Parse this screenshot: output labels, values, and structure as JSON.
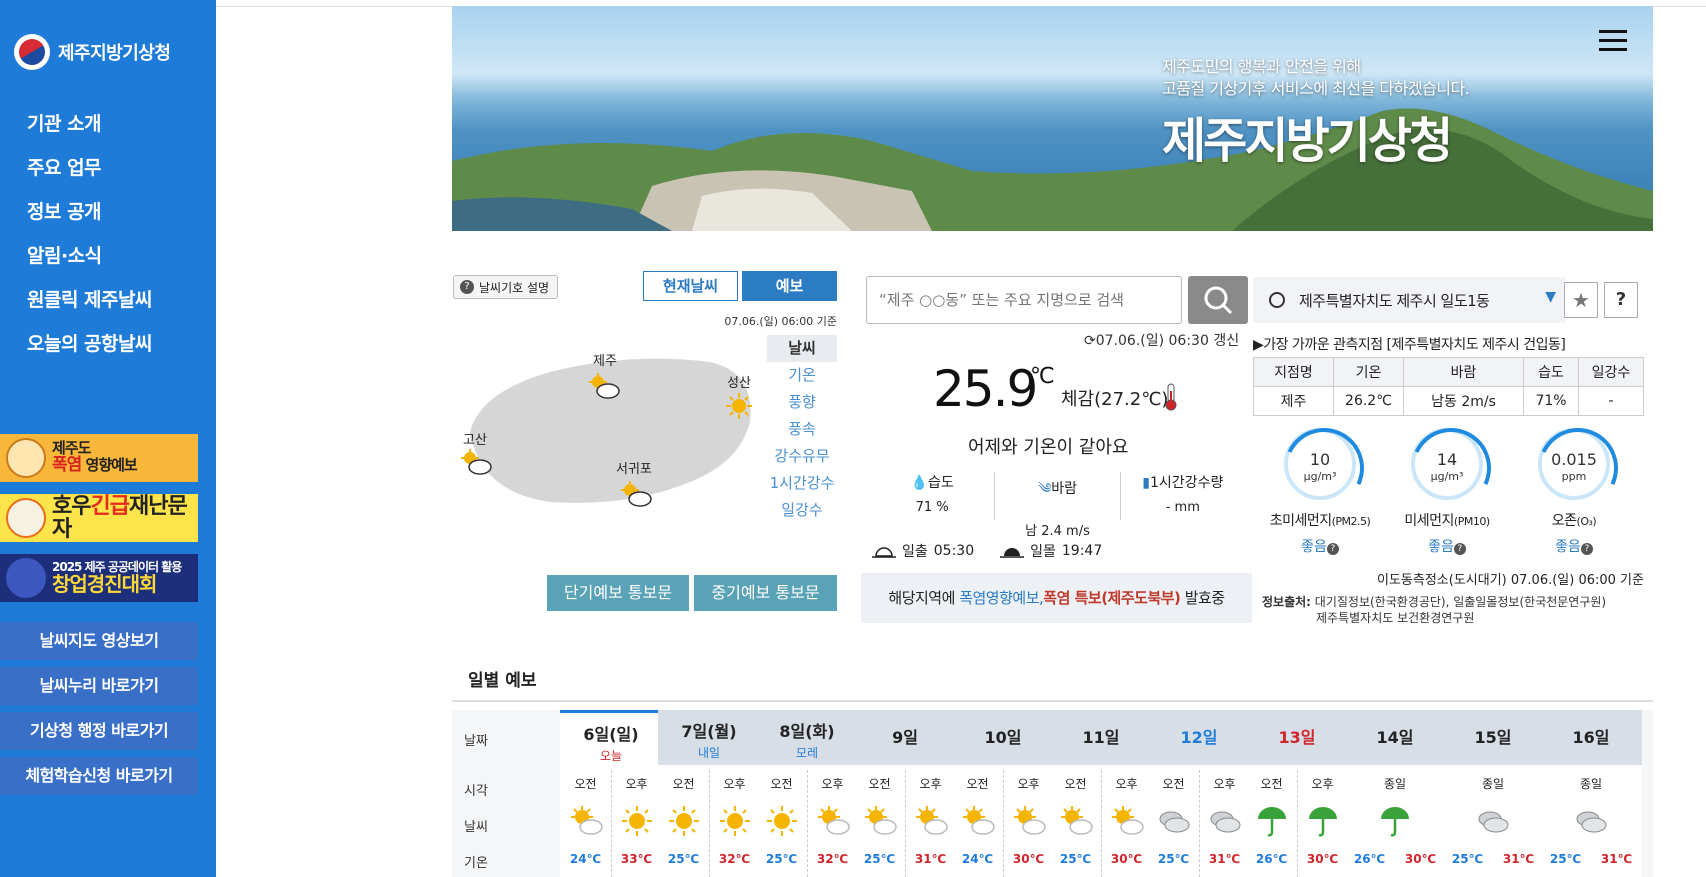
{
  "sidebar": {
    "logo_text": "제주지방기상청",
    "nav": [
      "기관 소개",
      "주요 업무",
      "정보 공개",
      "알림·소식",
      "원클릭 제주날씨",
      "오늘의 공항날씨"
    ],
    "banners": {
      "b1_top": "제주도",
      "b1_hl": "폭염",
      "b1_rest": "영향예보",
      "b2_pre": "호우",
      "b2_hl": "긴급",
      "b2_post": "재난문자",
      "b3_top": "2025 제주 공공데이터 활용",
      "b3_big": "창업경진대회"
    },
    "quick": [
      "날씨지도 영상보기",
      "날씨누리 바로가기",
      "기상청 행정 바로가기",
      "체험학습신청 바로가기"
    ]
  },
  "hero": {
    "line1": "제주도민의 행복과 안전을 위해",
    "line2": "고품질 기상기후 서비스에 최선을 다하겠습니다.",
    "title": "제주지방기상청"
  },
  "map": {
    "symbol_btn": "날씨기호 설명",
    "tab_current": "현재날씨",
    "tab_forecast": "예보",
    "time": "07.06.(일) 06:00 기준",
    "cities": [
      "제주",
      "성산",
      "고산",
      "서귀포"
    ],
    "layers": [
      "날씨",
      "기온",
      "풍향",
      "풍속",
      "강수유무",
      "1시간강수",
      "일강수"
    ],
    "bulletin_short": "단기예보 통보문",
    "bulletin_mid": "중기예보 통보문"
  },
  "current": {
    "search_placeholder": "“제주 ○○동” 또는 주요 지명으로 검색",
    "updated": "07.06.(일) 06:30 갱신",
    "temp": "25.9",
    "temp_unit": "℃",
    "feels": "체감(27.2℃)",
    "same_as": "어제와 기온이 같아요",
    "humidity_label": "습도",
    "humidity": "71 %",
    "wind_label": "바람",
    "wind": "남 2.4 m/s",
    "rain_label": "1시간강수량",
    "rain": "- mm",
    "sunrise_label": "일출",
    "sunrise": "05:30",
    "sunset_label": "일몰",
    "sunset": "19:47",
    "alert_pre": "해당지역에",
    "alert_a1": "폭염영향예보,",
    "alert_a2": "폭염 특보(제주도북부)",
    "alert_post": "발효중"
  },
  "location": {
    "name": "제주특별자치도 제주시 일도1동",
    "near": "▶가장 가까운 관측지점 [제주특별자치도 제주시 건입동]",
    "table_head": [
      "지점명",
      "기온",
      "바람",
      "습도",
      "일강수"
    ],
    "table_row": [
      "제주",
      "26.2℃",
      "남동 2m/s",
      "71%",
      "-"
    ],
    "dust": [
      {
        "num": "10",
        "unit": "μg/m³",
        "name": "초미세먼지",
        "sub": "(PM2.5)",
        "grade": "좋음"
      },
      {
        "num": "14",
        "unit": "μg/m³",
        "name": "미세먼지",
        "sub": "(PM10)",
        "grade": "좋음"
      },
      {
        "num": "0.015",
        "unit": "ppm",
        "name": "오존",
        "sub": "(O₃)",
        "grade": "좋음"
      }
    ],
    "measure": "이도동측정소(도시대기) 07.06.(일) 06:00 기준",
    "source_label": "정보출처:",
    "source_1": "대기질정보(한국환경공단), 일출일몰정보(한국천문연구원)",
    "source_2": "제주특별자치도 보건환경연구원"
  },
  "daily": {
    "title": "일별 예보",
    "labels": [
      "날짜",
      "시각",
      "날씨",
      "기온"
    ],
    "days": [
      {
        "d": "6일(일)",
        "sub": "오늘",
        "ampm": [
          "오전",
          "오후"
        ],
        "wx": [
          "partly",
          "sunny"
        ],
        "lo": "24℃",
        "hi": "33℃",
        "style": "today"
      },
      {
        "d": "7일(월)",
        "sub": "내일",
        "ampm": [
          "오전",
          "오후"
        ],
        "wx": [
          "sunny",
          "sunny"
        ],
        "lo": "25℃",
        "hi": "32℃",
        "style": "blue-sub"
      },
      {
        "d": "8일(화)",
        "sub": "모레",
        "ampm": [
          "오전",
          "오후"
        ],
        "wx": [
          "sunny",
          "partly"
        ],
        "lo": "25℃",
        "hi": "32℃",
        "style": "blue-sub"
      },
      {
        "d": "9일",
        "ampm": [
          "오전",
          "오후"
        ],
        "wx": [
          "partly",
          "partly"
        ],
        "lo": "25℃",
        "hi": "31℃"
      },
      {
        "d": "10일",
        "ampm": [
          "오전",
          "오후"
        ],
        "wx": [
          "partly",
          "partly"
        ],
        "lo": "24℃",
        "hi": "30℃"
      },
      {
        "d": "11일",
        "ampm": [
          "오전",
          "오후"
        ],
        "wx": [
          "partly",
          "partly"
        ],
        "lo": "25℃",
        "hi": "30℃"
      },
      {
        "d": "12일",
        "ampm": [
          "오전",
          "오후"
        ],
        "wx": [
          "cloudy",
          "cloudy"
        ],
        "lo": "25℃",
        "hi": "31℃",
        "style": "blue"
      },
      {
        "d": "13일",
        "ampm": [
          "오전",
          "오후"
        ],
        "wx": [
          "rain",
          "rain"
        ],
        "lo": "26℃",
        "hi": "30℃",
        "style": "red"
      },
      {
        "d": "14일",
        "ampm": [
          "종일"
        ],
        "wx": [
          "rain"
        ],
        "lo": "26℃",
        "hi": "30℃"
      },
      {
        "d": "15일",
        "ampm": [
          "종일"
        ],
        "wx": [
          "cloudy"
        ],
        "lo": "25℃",
        "hi": "31℃"
      },
      {
        "d": "16일",
        "ampm": [
          "종일"
        ],
        "wx": [
          "cloudy"
        ],
        "lo": "25℃",
        "hi": "31℃"
      }
    ]
  },
  "colors": {
    "sidebar": "#1f7bd8",
    "accent": "#2c7cc4",
    "red": "#d0242a"
  }
}
